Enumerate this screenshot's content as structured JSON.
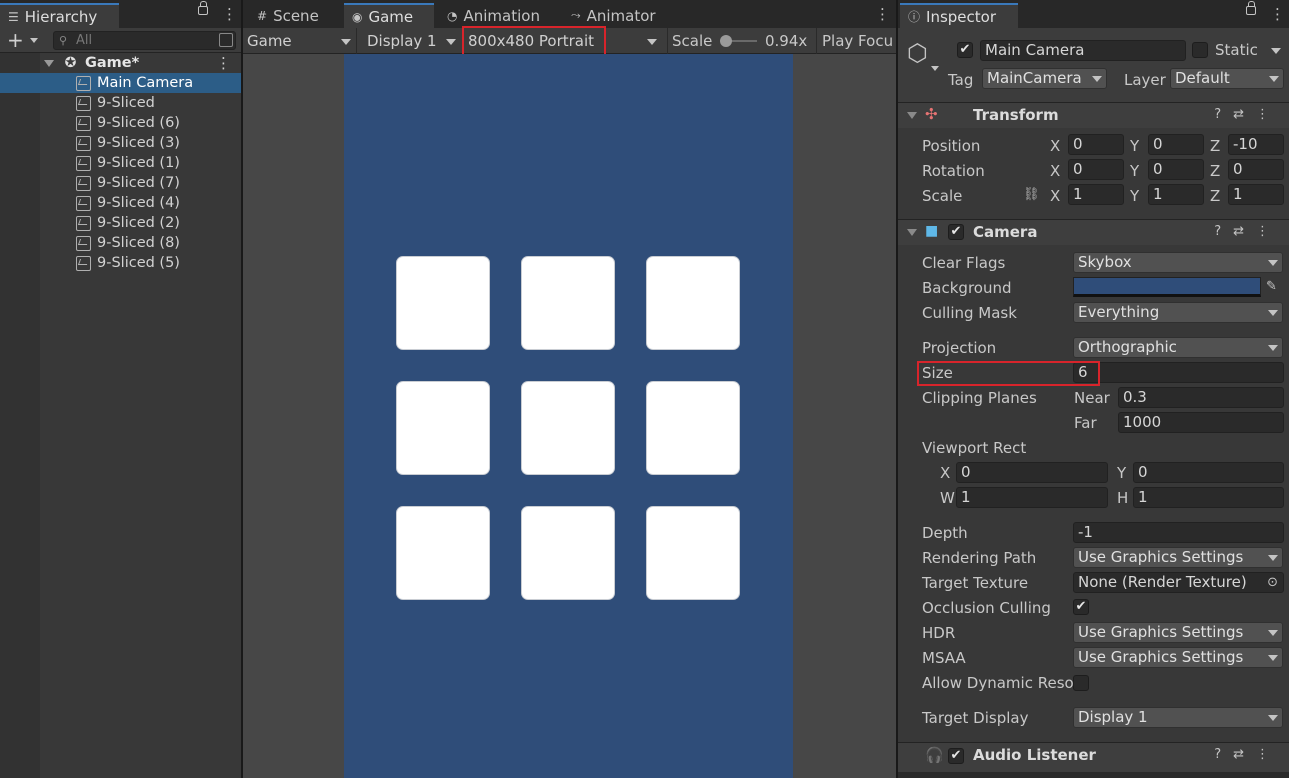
{
  "hierarchy": {
    "tab_label": "Hierarchy",
    "search_placeholder": "All",
    "scene_name": "Game*",
    "items": [
      {
        "label": "Main Camera",
        "selected": true
      },
      {
        "label": "9-Sliced"
      },
      {
        "label": "9-Sliced (6)"
      },
      {
        "label": "9-Sliced (3)"
      },
      {
        "label": "9-Sliced (1)"
      },
      {
        "label": "9-Sliced (7)"
      },
      {
        "label": "9-Sliced (4)"
      },
      {
        "label": "9-Sliced (2)"
      },
      {
        "label": "9-Sliced (8)"
      },
      {
        "label": "9-Sliced (5)"
      }
    ]
  },
  "center_tabs": {
    "scene": "Scene",
    "game": "Game",
    "animation": "Animation",
    "animator": "Animator"
  },
  "game_toolbar": {
    "view_select": "Game",
    "display_select": "Display 1",
    "resolution_select": "800x480 Portrait",
    "scale_label": "Scale",
    "scale_value": "0.94x",
    "play_focus": "Play Focu"
  },
  "game_view": {
    "background_color": "#2f4d79",
    "tile_color": "#ffffff",
    "tile_grid": {
      "rows": 3,
      "cols": 3
    }
  },
  "inspector": {
    "tab_label": "Inspector",
    "object_name": "Main Camera",
    "active": true,
    "static_label": "Static",
    "tag_label": "Tag",
    "tag_value": "MainCamera",
    "layer_label": "Layer",
    "layer_value": "Default",
    "transform": {
      "title": "Transform",
      "position_label": "Position",
      "rotation_label": "Rotation",
      "scale_label": "Scale",
      "position": {
        "x": "0",
        "y": "0",
        "z": "-10"
      },
      "rotation": {
        "x": "0",
        "y": "0",
        "z": "0"
      },
      "scale": {
        "x": "1",
        "y": "1",
        "z": "1"
      },
      "axis_x": "X",
      "axis_y": "Y",
      "axis_z": "Z"
    },
    "camera": {
      "title": "Camera",
      "enabled": true,
      "clear_flags_label": "Clear Flags",
      "clear_flags_value": "Skybox",
      "background_label": "Background",
      "background_color": "#2f4d79",
      "culling_mask_label": "Culling Mask",
      "culling_mask_value": "Everything",
      "projection_label": "Projection",
      "projection_value": "Orthographic",
      "size_label": "Size",
      "size_value": "6",
      "clipping_planes_label": "Clipping Planes",
      "near_label": "Near",
      "near_value": "0.3",
      "far_label": "Far",
      "far_value": "1000",
      "viewport_rect_label": "Viewport Rect",
      "vp_x_label": "X",
      "vp_x": "0",
      "vp_y_label": "Y",
      "vp_y": "0",
      "vp_w_label": "W",
      "vp_w": "1",
      "vp_h_label": "H",
      "vp_h": "1",
      "depth_label": "Depth",
      "depth_value": "-1",
      "rendering_path_label": "Rendering Path",
      "rendering_path_value": "Use Graphics Settings",
      "target_texture_label": "Target Texture",
      "target_texture_value": "None (Render Texture)",
      "occlusion_culling_label": "Occlusion Culling",
      "occlusion_culling": true,
      "hdr_label": "HDR",
      "hdr_value": "Use Graphics Settings",
      "msaa_label": "MSAA",
      "msaa_value": "Use Graphics Settings",
      "allow_dynamic_label": "Allow Dynamic Reso",
      "allow_dynamic": false,
      "target_display_label": "Target Display",
      "target_display_value": "Display 1"
    },
    "audio_listener": {
      "title": "Audio Listener",
      "enabled": true
    }
  },
  "accent_colors": {
    "highlight_box": "#d8242b",
    "selection": "#2c5d87"
  }
}
